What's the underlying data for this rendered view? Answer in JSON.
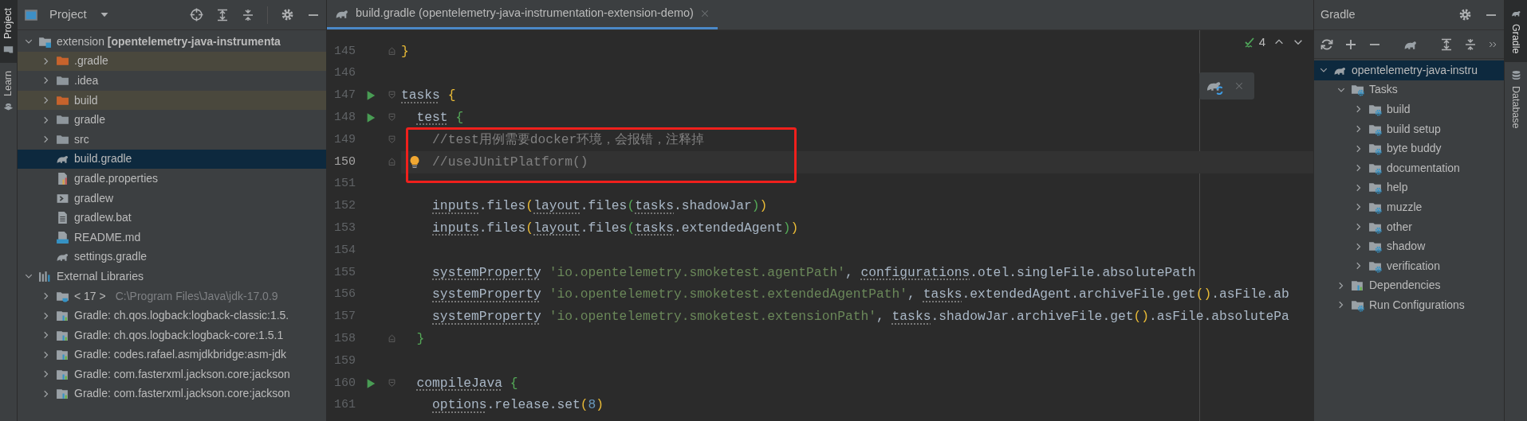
{
  "left_strip": [
    {
      "label": "Project",
      "kind": "folder",
      "selected": true
    },
    {
      "label": "Learn",
      "kind": "learn",
      "selected": false
    }
  ],
  "project_panel": {
    "title": "Project",
    "tree": [
      {
        "label": "extension **[opentelemetry-java-instrumenta**",
        "kind": "module",
        "selected": false,
        "expanded": true,
        "children": [
          {
            "label": ".gradle",
            "kind": "excluded",
            "selected": false,
            "expanded": false
          },
          {
            "label": ".idea",
            "kind": "folder",
            "selected": false,
            "expanded": false
          },
          {
            "label": "build",
            "kind": "excluded",
            "selected": false,
            "expanded": false
          },
          {
            "label": "gradle",
            "kind": "folder",
            "selected": false,
            "expanded": false
          },
          {
            "label": "src",
            "kind": "folder",
            "selected": false,
            "expanded": false
          },
          {
            "label": "build.gradle",
            "kind": "gradle",
            "selected": true
          },
          {
            "label": "gradle.properties",
            "kind": "properties",
            "selected": false
          },
          {
            "label": "gradlew",
            "kind": "script",
            "selected": false
          },
          {
            "label": "gradlew.bat",
            "kind": "batch",
            "selected": false
          },
          {
            "label": "README.md",
            "kind": "markdown",
            "selected": false
          },
          {
            "label": "settings.gradle",
            "kind": "gradle",
            "selected": false
          }
        ]
      },
      {
        "label": "External Libraries",
        "kind": "libraries",
        "selected": false,
        "expanded": true,
        "children": [
          {
            "label": "< 17 >",
            "detail": "C:\\Program Files\\Java\\jdk-17.0.9",
            "kind": "jdk",
            "selected": false,
            "expanded": false
          },
          {
            "label": "Gradle: ch.qos.logback:logback-classic:1.5.",
            "kind": "library",
            "selected": false,
            "expanded": false
          },
          {
            "label": "Gradle: ch.qos.logback:logback-core:1.5.1",
            "kind": "library",
            "selected": false,
            "expanded": false
          },
          {
            "label": "Gradle: codes.rafael.asmjdkbridge:asm-jdk",
            "kind": "library",
            "selected": false,
            "expanded": false
          },
          {
            "label": "Gradle: com.fasterxml.jackson.core:jackson",
            "kind": "library",
            "selected": false,
            "expanded": false
          },
          {
            "label": "Gradle: com.fasterxml.jackson.core:jackson",
            "kind": "library",
            "selected": false,
            "expanded": false
          }
        ]
      }
    ]
  },
  "editor": {
    "tab": {
      "title": "build.gradle (opentelemetry-java-instrumentation-extension-demo)",
      "selected": true
    },
    "inspections": "4",
    "lines": [
      {
        "number": "145",
        "run": false,
        "fold_open": false,
        "fold_close": true,
        "current": false,
        "boxed": false,
        "tokens": [
          {
            "text": "}",
            "kind": "outer"
          }
        ]
      },
      {
        "number": "146",
        "run": false,
        "fold_open": false,
        "fold_close": false,
        "current": false,
        "boxed": false
      },
      {
        "number": "147",
        "run": true,
        "fold_open": true,
        "fold_close": false,
        "current": false,
        "boxed": false,
        "tokens": [
          {
            "text": "tasks",
            "kind": "ref"
          },
          {
            "text": " {",
            "kind": "outer"
          }
        ]
      },
      {
        "number": "148",
        "run": true,
        "fold_open": true,
        "fold_close": false,
        "current": false,
        "boxed": false,
        "tokens": [
          {
            "text": "  test",
            "kind": "ref"
          },
          {
            "text": " {",
            "kind": "inner"
          }
        ]
      },
      {
        "number": "149",
        "run": false,
        "fold_open": true,
        "fold_close": false,
        "current": false,
        "boxed": true,
        "tokens": [
          {
            "text": "    //test用例需要docker环境，会报错，注释掉",
            "kind": "comment"
          }
        ]
      },
      {
        "number": "150",
        "run": false,
        "fold_open": false,
        "fold_close": true,
        "current": true,
        "bulb": true,
        "boxed": true,
        "tokens": [
          {
            "text": "    //useJUnitPlatform()",
            "kind": "comment"
          }
        ]
      },
      {
        "number": "151",
        "run": false,
        "fold_open": false,
        "fold_close": false,
        "current": false,
        "boxed": false
      },
      {
        "number": "152",
        "run": false,
        "fold_open": false,
        "fold_close": false,
        "current": false,
        "boxed": false,
        "tokens": [
          {
            "text": "    inputs",
            "kind": "ref"
          },
          {
            "text": ".files",
            "kind": "text"
          },
          {
            "text": "(",
            "kind": "outer"
          },
          {
            "text": "layout",
            "kind": "ref"
          },
          {
            "text": ".files",
            "kind": "text"
          },
          {
            "text": "(",
            "kind": "inner"
          },
          {
            "text": "tasks",
            "kind": "ref"
          },
          {
            "text": ".shadowJar",
            "kind": "text"
          },
          {
            "text": ")",
            "kind": "inner"
          },
          {
            "text": ")",
            "kind": "outer"
          }
        ]
      },
      {
        "number": "153",
        "run": false,
        "fold_open": false,
        "fold_close": false,
        "current": false,
        "boxed": false,
        "tokens": [
          {
            "text": "    inputs",
            "kind": "ref"
          },
          {
            "text": ".files",
            "kind": "text"
          },
          {
            "text": "(",
            "kind": "outer"
          },
          {
            "text": "layout",
            "kind": "ref"
          },
          {
            "text": ".files",
            "kind": "text"
          },
          {
            "text": "(",
            "kind": "inner"
          },
          {
            "text": "tasks",
            "kind": "ref"
          },
          {
            "text": ".extendedAgent",
            "kind": "text"
          },
          {
            "text": ")",
            "kind": "inner"
          },
          {
            "text": ")",
            "kind": "outer"
          }
        ]
      },
      {
        "number": "154",
        "run": false,
        "fold_open": false,
        "fold_close": false,
        "current": false,
        "boxed": false
      },
      {
        "number": "155",
        "run": false,
        "fold_open": false,
        "fold_close": false,
        "current": false,
        "boxed": false,
        "tokens": [
          {
            "text": "    systemProperty",
            "kind": "ref"
          },
          {
            "text": " 'io.opentelemetry.smoketest.agentPath'",
            "kind": "string"
          },
          {
            "text": ", ",
            "kind": "text"
          },
          {
            "text": "configurations",
            "kind": "ref"
          },
          {
            "text": ".otel.singleFile.absolutePath",
            "kind": "text"
          }
        ]
      },
      {
        "number": "156",
        "run": false,
        "fold_open": false,
        "fold_close": false,
        "current": false,
        "boxed": false,
        "tokens": [
          {
            "text": "    systemProperty",
            "kind": "ref"
          },
          {
            "text": " 'io.opentelemetry.smoketest.extendedAgentPath'",
            "kind": "string"
          },
          {
            "text": ", ",
            "kind": "text"
          },
          {
            "text": "tasks",
            "kind": "ref"
          },
          {
            "text": ".extendedAgent.archiveFile.get",
            "kind": "text"
          },
          {
            "text": "()",
            "kind": "outer"
          },
          {
            "text": ".asFile.ab",
            "kind": "text"
          }
        ]
      },
      {
        "number": "157",
        "run": false,
        "fold_open": false,
        "fold_close": false,
        "current": false,
        "boxed": false,
        "tokens": [
          {
            "text": "    systemProperty",
            "kind": "ref"
          },
          {
            "text": " 'io.opentelemetry.smoketest.extensionPath'",
            "kind": "string"
          },
          {
            "text": ", ",
            "kind": "text"
          },
          {
            "text": "tasks",
            "kind": "ref"
          },
          {
            "text": ".shadowJar.archiveFile.get",
            "kind": "text"
          },
          {
            "text": "()",
            "kind": "outer"
          },
          {
            "text": ".asFile.absolutePa",
            "kind": "text"
          }
        ]
      },
      {
        "number": "158",
        "run": false,
        "fold_open": false,
        "fold_close": true,
        "current": false,
        "boxed": false,
        "tokens": [
          {
            "text": "  }",
            "kind": "inner"
          }
        ]
      },
      {
        "number": "159",
        "run": false,
        "fold_open": false,
        "fold_close": false,
        "current": false,
        "boxed": false
      },
      {
        "number": "160",
        "run": true,
        "fold_open": true,
        "fold_close": false,
        "current": false,
        "boxed": false,
        "tokens": [
          {
            "text": "  compileJava",
            "kind": "ref"
          },
          {
            "text": " {",
            "kind": "inner"
          }
        ]
      },
      {
        "number": "161",
        "run": false,
        "fold_open": false,
        "fold_close": false,
        "current": false,
        "boxed": false,
        "tokens": [
          {
            "text": "    options",
            "kind": "ref"
          },
          {
            "text": ".release.set",
            "kind": "text"
          },
          {
            "text": "(",
            "kind": "outer"
          },
          {
            "text": "8",
            "kind": "number"
          },
          {
            "text": ")",
            "kind": "outer"
          }
        ]
      }
    ]
  },
  "gradle_panel": {
    "title": "Gradle",
    "tree": [
      {
        "label": "opentelemetry-java-instru",
        "kind": "project",
        "selected": true,
        "expanded": true,
        "children": [
          {
            "label": "Tasks",
            "kind": "tasks",
            "selected": false,
            "expanded": true,
            "children": [
              {
                "label": "build",
                "kind": "tasks",
                "selected": false,
                "expanded": false
              },
              {
                "label": "build setup",
                "kind": "tasks",
                "selected": false,
                "expanded": false
              },
              {
                "label": "byte buddy",
                "kind": "tasks",
                "selected": false,
                "expanded": false
              },
              {
                "label": "documentation",
                "kind": "tasks",
                "selected": false,
                "expanded": false
              },
              {
                "label": "help",
                "kind": "tasks",
                "selected": false,
                "expanded": false
              },
              {
                "label": "muzzle",
                "kind": "tasks",
                "selected": false,
                "expanded": false
              },
              {
                "label": "other",
                "kind": "tasks",
                "selected": false,
                "expanded": false
              },
              {
                "label": "shadow",
                "kind": "tasks",
                "selected": false,
                "expanded": false
              },
              {
                "label": "verification",
                "kind": "tasks",
                "selected": false,
                "expanded": false
              }
            ]
          },
          {
            "label": "Dependencies",
            "kind": "library",
            "selected": false,
            "expanded": false
          },
          {
            "label": "Run Configurations",
            "kind": "tasks",
            "selected": false,
            "expanded": false
          }
        ]
      }
    ]
  },
  "right_strip": [
    {
      "label": "Gradle",
      "kind": "gradle",
      "selected": true
    },
    {
      "label": "Database",
      "kind": "database",
      "selected": false
    }
  ]
}
